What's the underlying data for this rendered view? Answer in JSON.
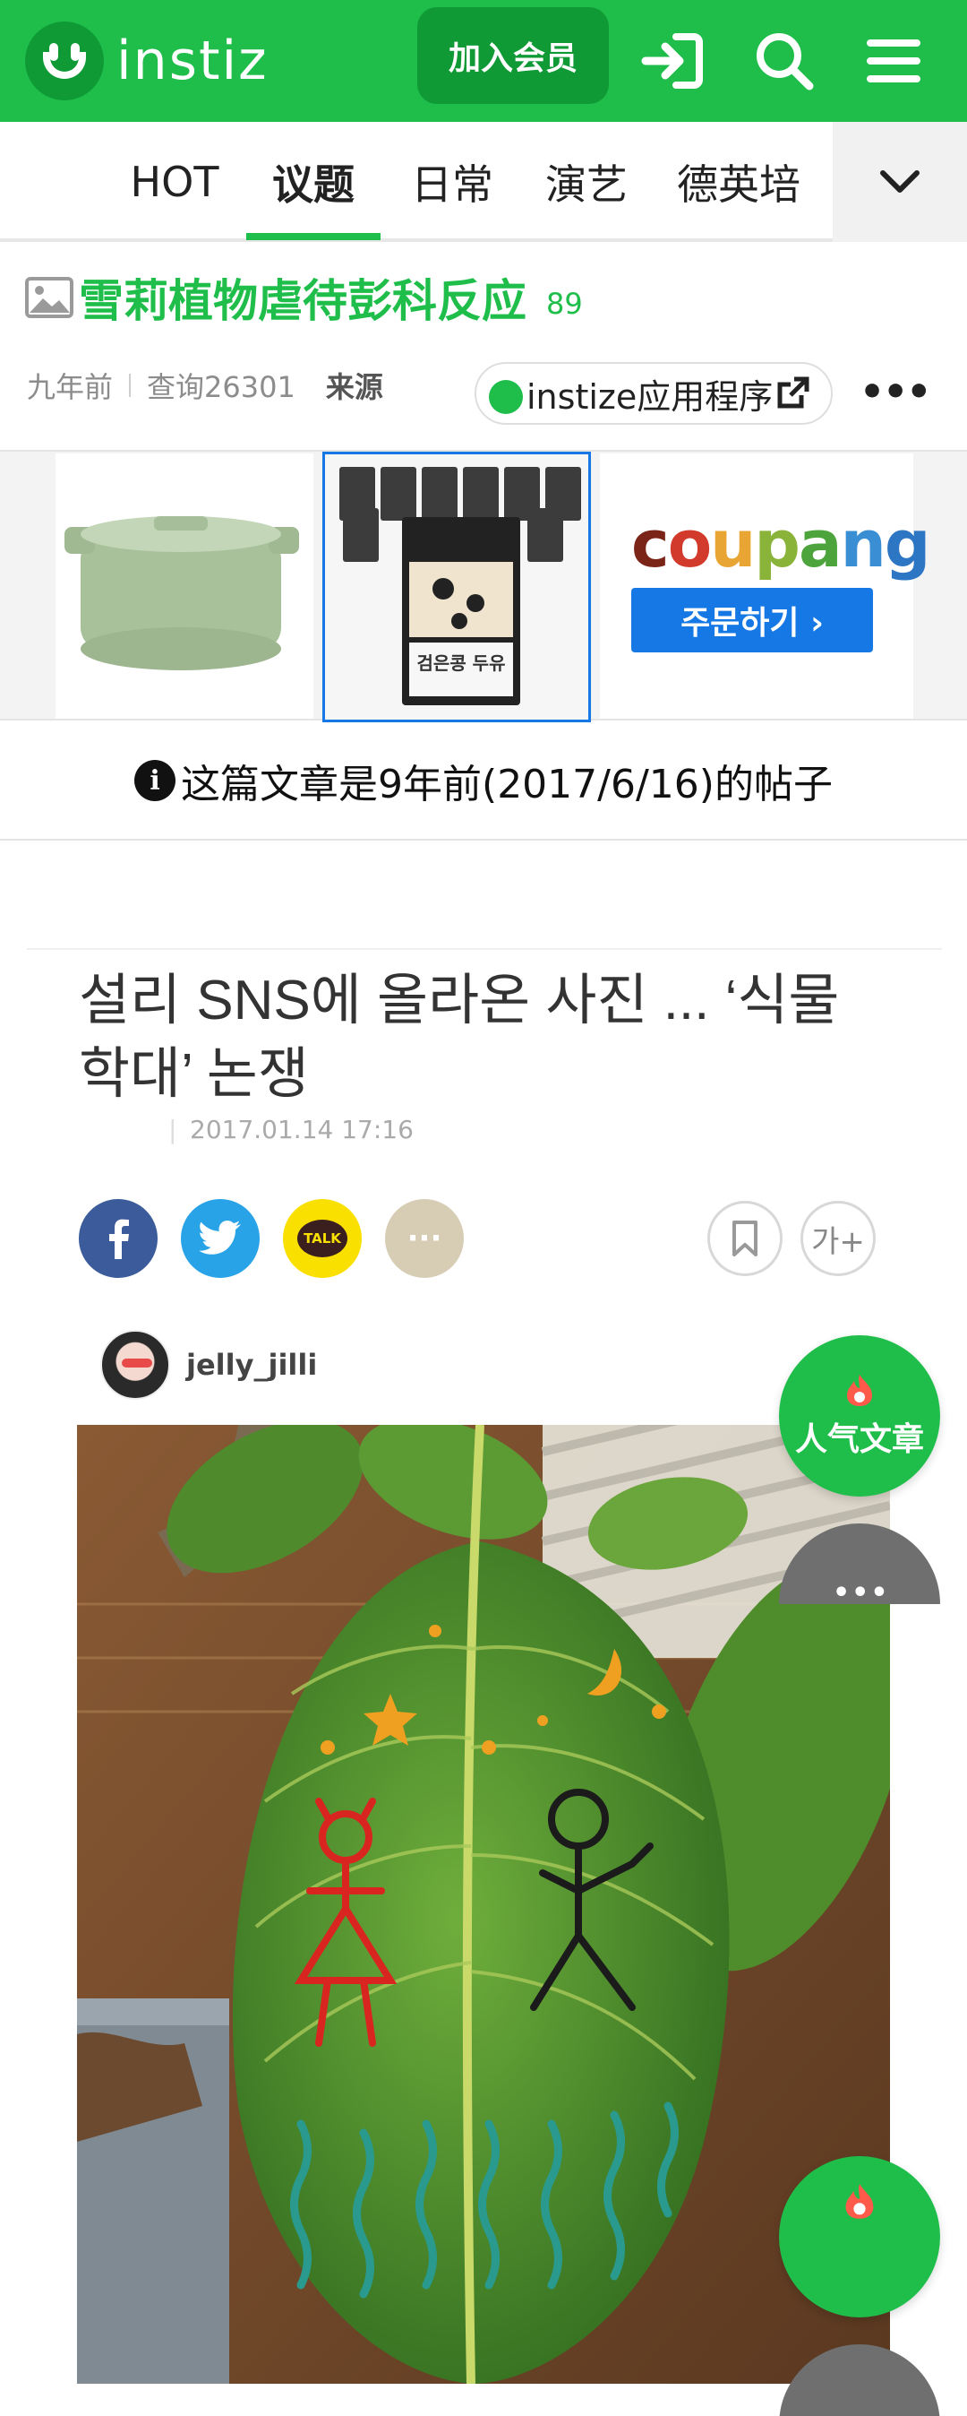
{
  "header": {
    "logo_text": "instiz",
    "join_label": "加入会员",
    "icons": [
      "login-icon",
      "search-icon",
      "menu-icon"
    ],
    "brand_color": "#1fbe4a"
  },
  "tabs": {
    "items": [
      {
        "label": "HOT"
      },
      {
        "label": "议题",
        "active": true
      },
      {
        "label": "日常"
      },
      {
        "label": "演艺"
      },
      {
        "label": "德英培"
      }
    ]
  },
  "post": {
    "title": "雪莉植物虐待彭科反应",
    "count": "89",
    "time_ago": "九年前",
    "views": "查询26301",
    "source": "来源",
    "app_link": "instize应用程序"
  },
  "ad": {
    "brand": "coupang",
    "order_label": "주문하기 ›"
  },
  "notice": {
    "text": "这篇文章是9年前(2017/6/16)的帖子"
  },
  "article": {
    "headline": "설리 SNS에 올라온 사진 ... ‘식물 학대’ 논쟁",
    "date": "2017.01.14 17:16",
    "kakao_label": "TALK",
    "font_size_label": "가+",
    "author": "jelly_jilli"
  },
  "floating": {
    "popular_label": "人气文章",
    "more_dots": "•••"
  }
}
